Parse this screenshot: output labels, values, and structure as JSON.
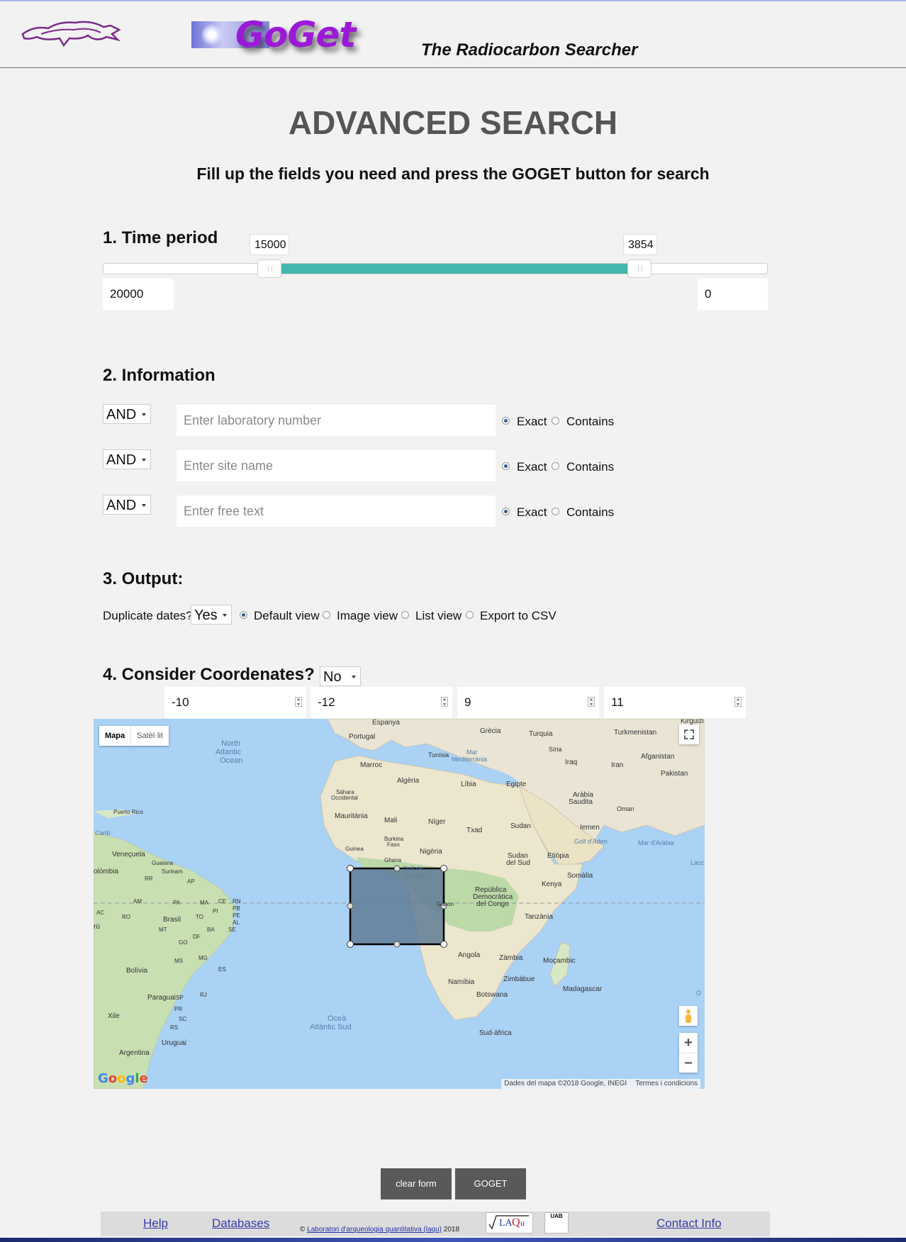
{
  "header": {
    "brand": "GoGet",
    "tagline": "The Radiocarbon Searcher"
  },
  "page": {
    "title": "ADVANCED SEARCH",
    "subtitle": "Fill up the fields you need and press the GOGET button for search"
  },
  "time_period": {
    "title": "1. Time period",
    "slider_from_label": "15000",
    "slider_to_label": "3854",
    "range_min": "20000",
    "range_max": "0",
    "selected_from": 15000,
    "selected_to": 3854
  },
  "information": {
    "title": "2. Information",
    "rows": [
      {
        "operator": "AND",
        "placeholder": "Enter laboratory number",
        "exact_label": "Exact",
        "contains_label": "Contains",
        "mode": "Exact"
      },
      {
        "operator": "AND",
        "placeholder": "Enter site name",
        "exact_label": "Exact",
        "contains_label": "Contains",
        "mode": "Exact"
      },
      {
        "operator": "AND",
        "placeholder": "Enter free text",
        "exact_label": "Exact",
        "contains_label": "Contains",
        "mode": "Exact"
      }
    ]
  },
  "output": {
    "title": "3. Output:",
    "duplicate_label": "Duplicate dates?",
    "duplicate_value": "Yes",
    "views": [
      "Default view",
      "Image view",
      "List view",
      "Export to CSV"
    ],
    "selected_view": "Default view"
  },
  "coordinates": {
    "title": "4. Consider Coordenates?",
    "consider_value": "No",
    "values": [
      "-10",
      "-12",
      "9",
      "11"
    ]
  },
  "map": {
    "type_map": "Mapa",
    "type_satellite": "Satèl·lit",
    "google_logo": "Google",
    "attribution": "Dades del mapa ©2018 Google, INEGI",
    "terms": "Termes i condicions",
    "labels": {
      "espanya": "Espanya",
      "portugal": "Portugal",
      "grecia": "Grècia",
      "turquia": "Turquia",
      "turkmenistan": "Turkmenistan",
      "kirguizi": "Kirguizi",
      "north": "North",
      "atlantic": "Atlantic",
      "ocean": "Ocean",
      "tunisia": "Tunísia",
      "mar": "Mar",
      "mediterrania": "Mediterrània",
      "siria": "Síria",
      "iraq": "Iraq",
      "iran": "Iran",
      "afganistan": "Afganistan",
      "pakistan": "Pakistan",
      "marroc": "Marroc",
      "algeria": "Algèria",
      "libia": "Líbia",
      "egipte": "Egipte",
      "sahara": "Sàhara",
      "occidental": "Occidental",
      "arabia": "Aràbia",
      "saudita": "Saudita",
      "oman": "Oman",
      "puerto_rico": "Puerto Rico",
      "mauritania": "Mauritània",
      "mali": "Mali",
      "niger": "Níger",
      "txad": "Txad",
      "sudan": "Sudan",
      "iemen": "Iemen",
      "carib": "Carib",
      "burkina": "Burkina",
      "faso": "Faso",
      "golf_aden": "Golf d'Aden",
      "mar_arabia": "Mar d'Aràbia",
      "guinea": "Guinea",
      "nigeria": "Nigèria",
      "ghana": "Ghana",
      "sudan_sud": "Sudan",
      "del_sud": "del Sud",
      "etiopia": "Etiòpia",
      "venecuela": "Veneçuela",
      "guaiana": "Guaiana",
      "surinam": "Surinam",
      "colombia": "olòmbia",
      "lacc": "Lacc",
      "golf_de": "Golf de",
      "guinea2": "Guinea",
      "somalia": "Somàlia",
      "ap": "AP",
      "rr": "RR",
      "gabon": "Gabon",
      "republica": "República",
      "democratica": "Democràtica",
      "del_congo": "del Congo",
      "kenya": "Kenya",
      "am": "AM",
      "pa": "PA",
      "ma": "MA",
      "ce": "CE",
      "rn": "RN",
      "pb": "PB",
      "pe": "PE",
      "pi": "PI",
      "ac": "AC",
      "ro": "RO",
      "to": "TO",
      "al": "AL",
      "se": "SE",
      "brasil": "Brasil",
      "ru": "rú",
      "tanzania": "Tanzània",
      "mt": "MT",
      "ba": "BA",
      "df": "DF",
      "go": "GO",
      "angola": "Angola",
      "zambia": "Zàmbia",
      "mocambic": "Moçambic",
      "bolivia": "Bolívia",
      "ms": "MS",
      "mg": "MG",
      "es": "ES",
      "namibia": "Namíbia",
      "zimbabue": "Zimbàbue",
      "madagascar": "Madagascar",
      "paraguai": "Paraguai",
      "sp": "SP",
      "rj": "RJ",
      "botswana": "Botswana",
      "xile": "Xile",
      "pr": "PR",
      "sc": "SC",
      "rs": "RS",
      "ocea": "Oceà",
      "atlantic_sud": "Atlàntic Sud",
      "uruguai": "Uruguai",
      "sud_africa": "Sud-àfrica",
      "argentina": "Argentina",
      "o": "O"
    }
  },
  "actions": {
    "clear": "clear form",
    "search": "GOGET"
  },
  "footer": {
    "help": "Help",
    "databases": "Databases",
    "copyright_prefix": "©",
    "lab_link": "Laboratori d'arqueologia quantitativa (laqu)",
    "year": "2018",
    "contact": "Contact Info",
    "uab": "UAB"
  },
  "colors": {
    "brand_purple": "#9b19d6",
    "slider_fill": "#45b7ac",
    "button_bg": "#595959",
    "selection_fill": "#607b95"
  }
}
